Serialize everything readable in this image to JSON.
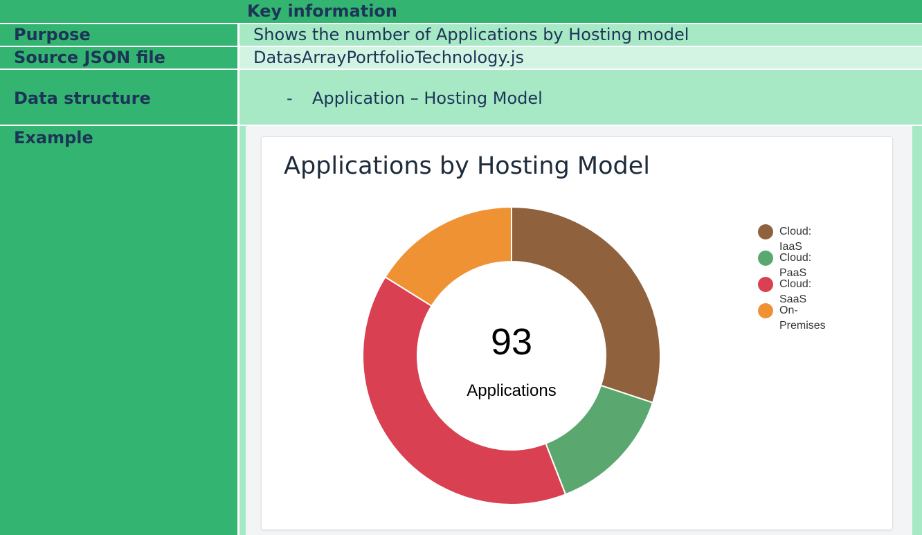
{
  "table": {
    "header": "Key information",
    "rows": {
      "purpose": {
        "label": "Purpose",
        "value": "Shows the number of Applications by Hosting model"
      },
      "source": {
        "label": "Source JSON file",
        "value": "DatasArrayPortfolioTechnology.js"
      },
      "structure": {
        "label": "Data structure",
        "bullet": "-",
        "value": "Application – Hosting Model"
      },
      "example": {
        "label": "Example"
      }
    }
  },
  "chart_data": {
    "type": "pie",
    "title": "Applications by Hosting Model",
    "center_value": "93",
    "center_label": "Applications",
    "categories": [
      "Cloud: IaaS",
      "Cloud: PaaS",
      "Cloud: SaaS",
      "On-Premises"
    ],
    "values": [
      28,
      13,
      37,
      15
    ],
    "colors": [
      "#8f613c",
      "#5aa86f",
      "#d94052",
      "#ef9234"
    ],
    "legend_position": "top-right"
  }
}
